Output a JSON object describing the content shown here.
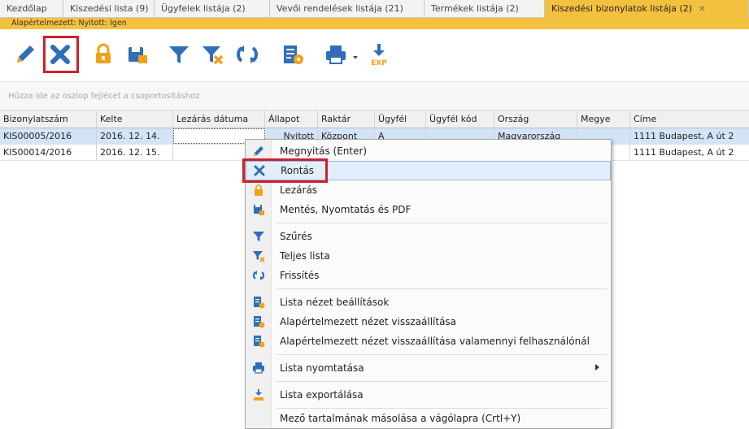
{
  "tabs": [
    {
      "label": "Kezdőlap"
    },
    {
      "label": "Kiszedési lista (9)"
    },
    {
      "label": "Ügyfelek listája (2)"
    },
    {
      "label": "Vevői rendelések listája (21)"
    },
    {
      "label": "Termékek listája (2)"
    },
    {
      "label": "Kiszedési bizonylatok listája (2)",
      "active": true
    }
  ],
  "tab_close": "✕",
  "statusline": "Alapértelmezett: Nyitott: Igen",
  "toolbar": {
    "icons": [
      "pencil-icon",
      "delete-x-icon",
      "lock-icon",
      "save-print-icon",
      "filter-icon",
      "filter-clear-icon",
      "refresh-icon",
      "list-settings-icon",
      "printer-icon",
      "export-icon"
    ],
    "export_label": "EXP"
  },
  "groupbar_hint": "Húzza ide az oszlop fejlécet a csoportosításhoz",
  "grid": {
    "columns": [
      "Bizonylatszám",
      "Kelte",
      "Lezárás dátuma",
      "Állapot",
      "Raktár",
      "Ügyfél",
      "Ügyfél kód",
      "Ország",
      "Megye",
      "Címe"
    ],
    "rows": [
      [
        "KIS00005/2016",
        "2016. 12. 14.",
        "",
        "Nyitott",
        "Központ",
        "A",
        "",
        "Magyarország",
        "",
        "1111 Budapest, A út 2"
      ],
      [
        "KIS00014/2016",
        "2016. 12. 15.",
        "",
        "",
        "",
        "",
        "",
        "",
        "",
        "1111 Budapest, A út 2"
      ]
    ]
  },
  "context_menu": {
    "items": [
      {
        "label": "Megnyitás (Enter)",
        "icon": "pencil-icon"
      },
      {
        "label": "Rontás",
        "icon": "delete-x-icon"
      },
      {
        "label": "Lezárás",
        "icon": "lock-icon"
      },
      {
        "label": "Mentés, Nyomtatás és PDF",
        "icon": "save-print-icon"
      },
      {
        "label": "Szűrés",
        "icon": "filter-icon"
      },
      {
        "label": "Teljes lista",
        "icon": "filter-clear-icon"
      },
      {
        "label": "Frissítés",
        "icon": "refresh-icon"
      },
      {
        "label": "Lista nézet beállítások",
        "icon": "list-settings-icon"
      },
      {
        "label": "Alapértelmezett nézet visszaállítása",
        "icon": "list-settings-icon"
      },
      {
        "label": "Alapértelmezett nézet visszaállítása valamennyi felhasználónál",
        "icon": "list-settings-icon"
      },
      {
        "label": "Lista nyomtatása",
        "icon": "printer-icon"
      },
      {
        "label": "Lista exportálása",
        "icon": "export-icon"
      },
      {
        "label": "Mező tartalmának másolása a vágólapra (Crtl+Y)",
        "icon": ""
      }
    ]
  },
  "colors": {
    "active_tab": "#f4c13e",
    "highlight": "#d0202a",
    "selected_row": "#d4e4f7",
    "menu_hover": "#e3eefb",
    "icon_blue": "#2f6fb7",
    "icon_orange": "#f0a21b"
  }
}
